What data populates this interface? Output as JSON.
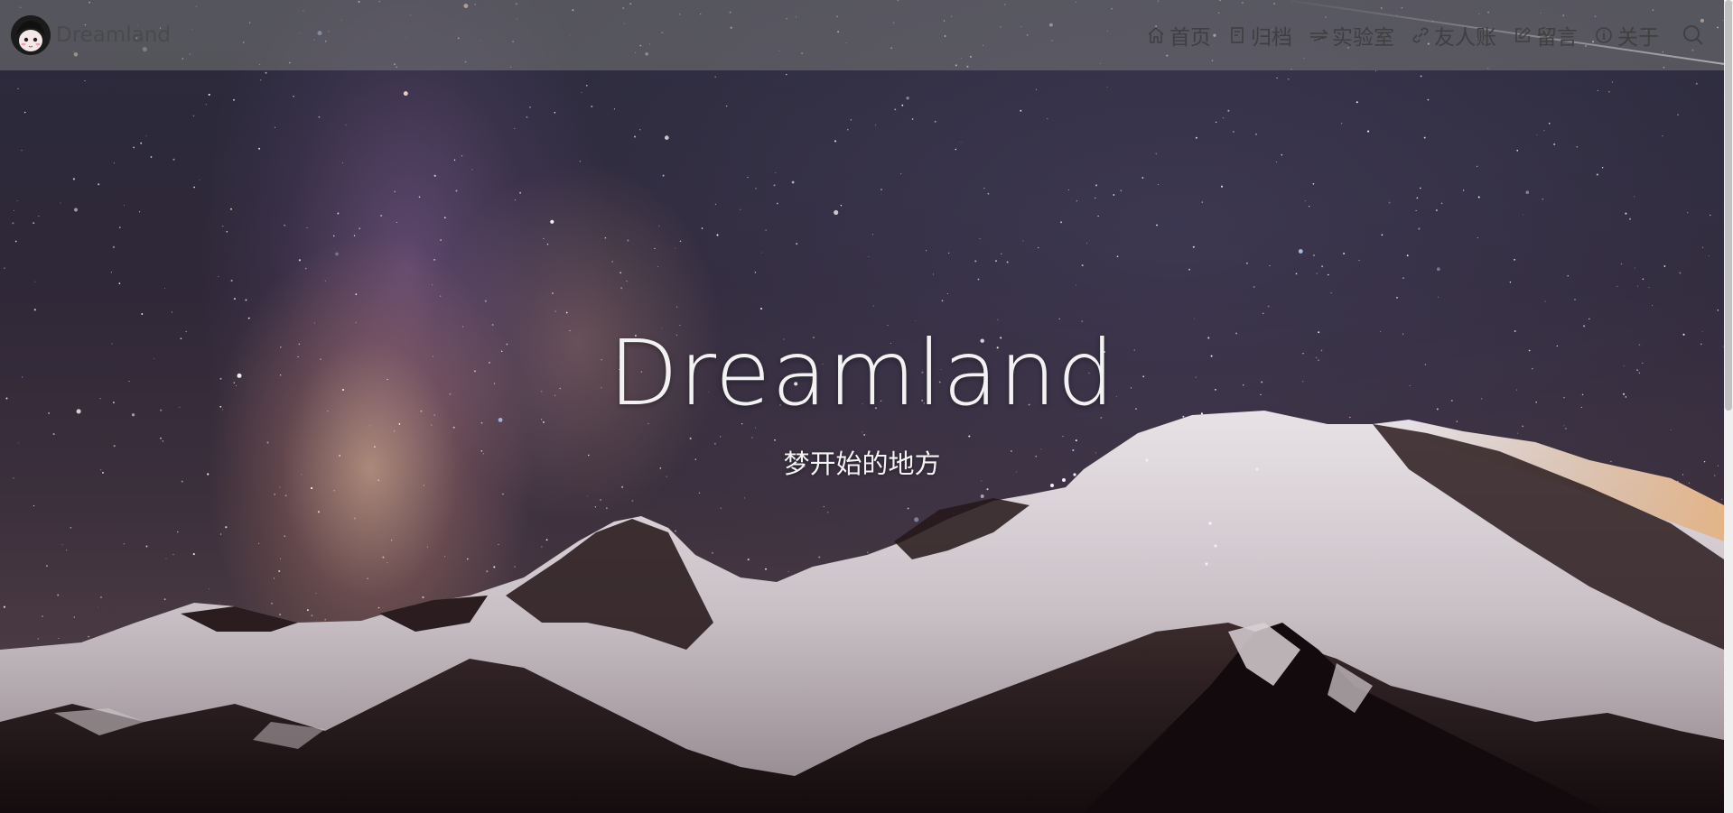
{
  "site": {
    "brand_name": "Dreamland",
    "avatar_icon": "anime-girl-avatar-icon"
  },
  "nav": {
    "items": [
      {
        "label": "首页",
        "icon": "home-icon"
      },
      {
        "label": "归档",
        "icon": "archive-icon"
      },
      {
        "label": "实验室",
        "icon": "lab-icon"
      },
      {
        "label": "友人账",
        "icon": "link-icon"
      },
      {
        "label": "留言",
        "icon": "edit-icon"
      },
      {
        "label": "关于",
        "icon": "info-icon"
      }
    ],
    "search_icon": "search-icon"
  },
  "hero": {
    "title": "Dreamland",
    "subtitle": "梦开始的地方"
  },
  "colors": {
    "navbar_bg": "#787878",
    "nav_text": "#3f3f3f",
    "hero_text": "#f2f2f2"
  }
}
